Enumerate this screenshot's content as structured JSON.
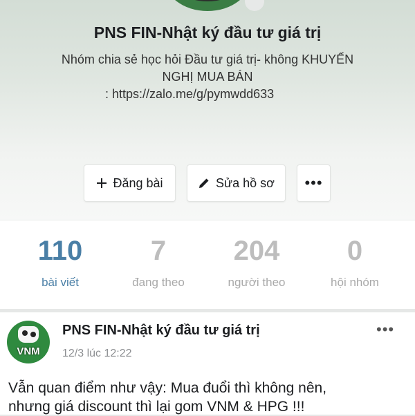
{
  "profile": {
    "title": "PNS FIN-Nhật ký đầu tư giá trị",
    "description_line1": "Nhóm chia sẻ học hỏi Đầu tư giá trị- không KHUYẾN",
    "description_line2": "NGHỊ MUA BÁN",
    "description_line3": ": https://zalo.me/g/pymwdd633"
  },
  "actions": {
    "post_label": "Đăng bài",
    "post_icon": "plus-icon",
    "edit_label": "Sửa hồ sơ",
    "edit_icon": "pencil-icon",
    "more_label": "•••"
  },
  "stats": [
    {
      "value": "110",
      "label": "bài viết",
      "active": true
    },
    {
      "value": "7",
      "label": "đang theo",
      "active": false
    },
    {
      "value": "204",
      "label": "người theo",
      "active": false
    },
    {
      "value": "0",
      "label": "hội nhóm",
      "active": false
    }
  ],
  "post": {
    "author": "PNS FIN-Nhật ký đầu tư giá trị",
    "avatar_text": "VNM",
    "time": "12/3 lúc 12:22",
    "more_label": "•••",
    "text_line1": "Vẫn quan điểm như vậy: Mua đuổi thì không nên,",
    "text_line2": "nhưng giá discount thì lại gom VNM & HPG !!!"
  },
  "colors": {
    "active_stat": "#4a7fa6",
    "inactive_stat": "#bdbdbd",
    "avatar_green": "#2f8a3f"
  }
}
